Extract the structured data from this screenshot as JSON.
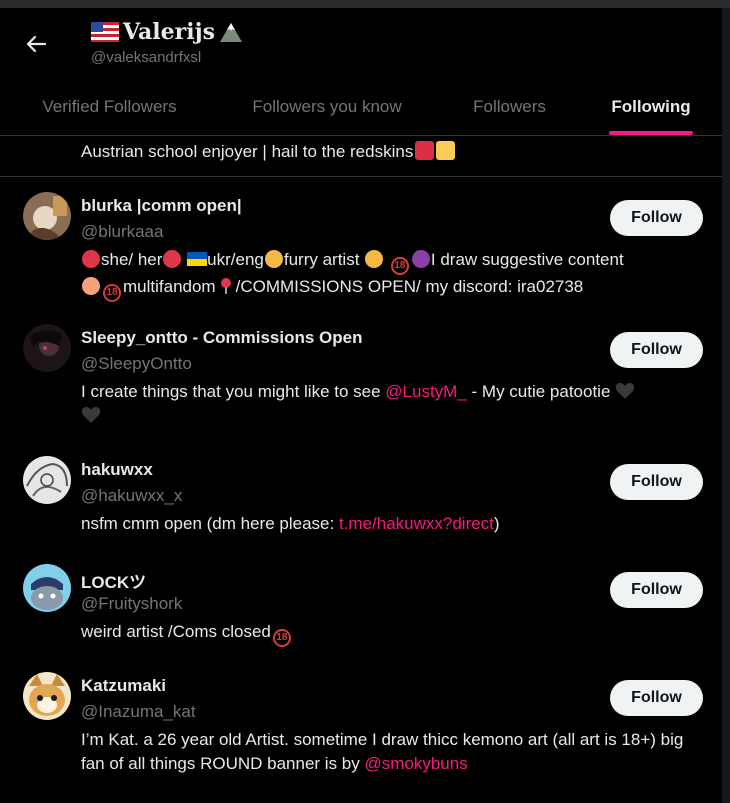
{
  "header": {
    "title": "Valerijs",
    "handle": "@valeksandrfxsl"
  },
  "tabs": [
    {
      "label": "Verified Followers"
    },
    {
      "label": "Followers you know"
    },
    {
      "label": "Followers"
    },
    {
      "label": "Following",
      "active": true
    }
  ],
  "partial_bio": "Austrian school enjoyer | hail to the redskins",
  "users": [
    {
      "name": "blurka |comm open|",
      "handle": "@blurkaaa",
      "bio_line1": "she/ her",
      "bio_line1b": "ukr/eng",
      "bio_line1c": "furry artist",
      "bio_line1d": "I draw suggestive content",
      "bio_line2a": "multifandom",
      "bio_line2b": "/COMMISSIONS OPEN/ my discord: ira02738",
      "follow_label": "Follow"
    },
    {
      "name": "Sleepy_ontto - Commissions Open",
      "handle": "@SleepyOntto",
      "bio_a": "I create things that you might like to see ",
      "bio_link": "@LustyM_",
      "bio_b": " - My cutie patootie",
      "follow_label": "Follow"
    },
    {
      "name": "hakuwxx",
      "handle": "@hakuwxx_x",
      "bio_a": "nsfm cmm open (dm here please: ",
      "bio_link": "t.me/hakuwxx?direct",
      "bio_b": ")",
      "follow_label": "Follow"
    },
    {
      "name": "LOCKツ",
      "handle": "@Fruityshork",
      "bio_a": "weird artist /Coms closed",
      "follow_label": "Follow"
    },
    {
      "name": "Katzumaki",
      "handle": "@Inazuma_kat",
      "bio_a": "I’m Kat. a 26 year old Artist. sometime I draw thicc kemono art (all art is 18+) big fan of all things ROUND banner is by ",
      "bio_link": "@smokybuns",
      "follow_label": "Follow"
    }
  ],
  "badge_18": "18",
  "colors": {
    "accent": "#f91880",
    "background": "#000000",
    "muted_text": "#71767b",
    "primary_text": "#e7e9ea",
    "button_bg": "#eff3f4"
  }
}
